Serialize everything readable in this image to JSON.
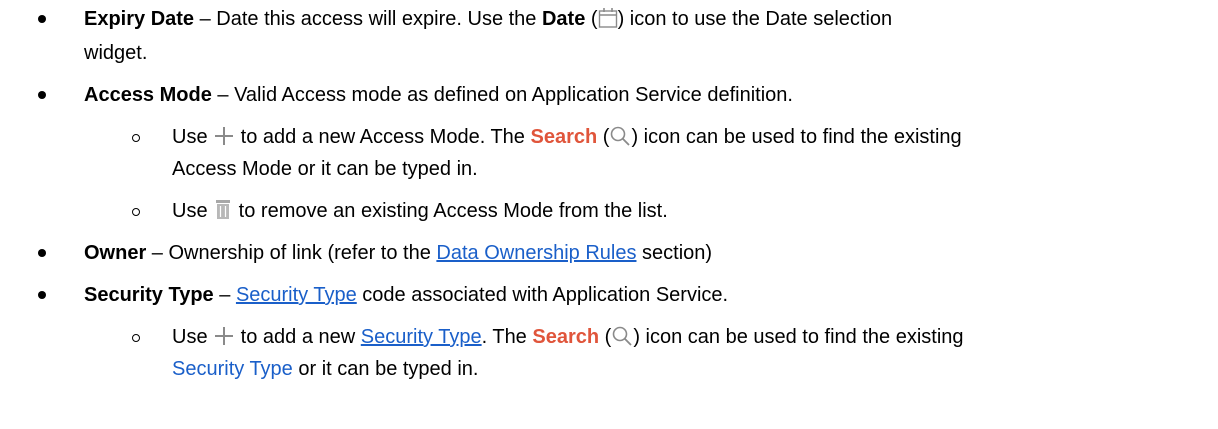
{
  "items": {
    "expiry": {
      "label": "Expiry Date",
      "t1": " – Date this access will expire. Use the ",
      "date_word": "Date",
      "t2": " (",
      "t3": ") icon to use the Date selection",
      "line2": "widget."
    },
    "access_mode": {
      "label": "Access Mode",
      "text": " – Valid Access mode as defined on Application Service definition.",
      "sub1": {
        "t1": "Use ",
        "t2": " to add a new Access Mode. The ",
        "search_word": "Search",
        "t3": " (",
        "t4": ") icon can be used to find the existing",
        "line2": "Access Mode or it can be typed in."
      },
      "sub2": {
        "t1": "Use ",
        "t2": " to remove an existing Access Mode from the list."
      }
    },
    "owner": {
      "label": "Owner",
      "t1": " – Ownership of link (refer to the ",
      "link": "Data Ownership Rules",
      "t2": " section)"
    },
    "security_type": {
      "label": "Security Type",
      "t1": " – ",
      "link": "Security Type",
      "t2": " code associated with Application Service.",
      "sub1": {
        "t1": "Use ",
        "t2": " to add a new ",
        "link": "Security Type",
        "t3": ". The ",
        "search_word": "Search",
        "t4": " (",
        "t5": ") icon can be used to find the existing",
        "line2_link": "Security Type",
        "line2_rest": " or it can be typed in."
      }
    }
  },
  "colors": {
    "link": "#1a5fc9",
    "search_word": "#e0553b",
    "icon_gray": "#8a8a8a"
  },
  "icons": [
    "calendar-icon",
    "plus-icon",
    "search-icon",
    "trash-icon"
  ]
}
